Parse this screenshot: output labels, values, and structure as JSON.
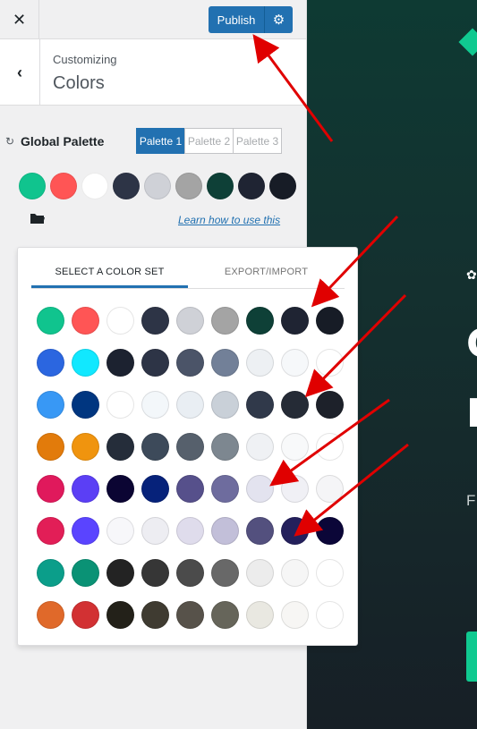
{
  "topbar": {
    "close_label": "✕",
    "publish_label": "Publish",
    "gear_icon": "⚙"
  },
  "section": {
    "back_icon": "‹",
    "breadcrumb": "Customizing",
    "title": "Colors"
  },
  "global_palette": {
    "reset_icon": "↻",
    "label": "Global Palette",
    "tabs": [
      "Palette 1",
      "Palette 2",
      "Palette 3"
    ],
    "active_tab": "Palette 1",
    "swatches": [
      "#10c48e",
      "#ff5555",
      "#ffffff",
      "#2d3446",
      "#cfd1d7",
      "#a4a4a4",
      "#0e4037",
      "#1f2433",
      "#171c26"
    ],
    "learn_link": "Learn how to use this"
  },
  "popup": {
    "tabs": [
      "SELECT A COLOR SET",
      "EXPORT/IMPORT"
    ],
    "active_tab": "SELECT A COLOR SET",
    "color_sets": [
      [
        "#10c48e",
        "#ff5555",
        "#ffffff",
        "#2d3446",
        "#cfd1d7",
        "#a4a4a4",
        "#0e4037",
        "#1f2433",
        "#171c26"
      ],
      [
        "#2b66e0",
        "#11e8ff",
        "#1c2230",
        "#2d3446",
        "#4b5468",
        "#728098",
        "#edf0f3",
        "#f6f8fa",
        "#ffffff"
      ],
      [
        "#3898f5",
        "#003680",
        "#ffffff",
        "#f3f7fa",
        "#e9eef3",
        "#c9d0d8",
        "#30394a",
        "#252b36",
        "#1d212a"
      ],
      [
        "#e27b0b",
        "#f0940e",
        "#252d3a",
        "#3d4a5a",
        "#56606c",
        "#7d8790",
        "#eff1f4",
        "#f8f9fa",
        "#ffffff"
      ],
      [
        "#e0195c",
        "#5b3ff5",
        "#0b0533",
        "#06227a",
        "#56508b",
        "#6e6c9e",
        "#e3e3ef",
        "#f0f0f5",
        "#f5f5f7"
      ],
      [
        "#e21e57",
        "#5a44ff",
        "#f7f7fa",
        "#ededf2",
        "#dfdcec",
        "#c2bfd9",
        "#53507e",
        "#24205c",
        "#0b0638"
      ],
      [
        "#0b9e8a",
        "#0a9275",
        "#232323",
        "#363636",
        "#4b4b4b",
        "#686868",
        "#ececec",
        "#f6f6f6",
        "#ffffff"
      ],
      [
        "#e0692a",
        "#d23133",
        "#232119",
        "#3f3b31",
        "#57524a",
        "#66655a",
        "#e9e8e1",
        "#f7f6f4",
        "#ffffff"
      ]
    ]
  },
  "preview": {
    "badge_icon": "✿",
    "line1": "C",
    "line2": "I",
    "para": "F tr ta"
  },
  "colors": {
    "accent": "#2271b1",
    "annotation": "#e00000"
  }
}
